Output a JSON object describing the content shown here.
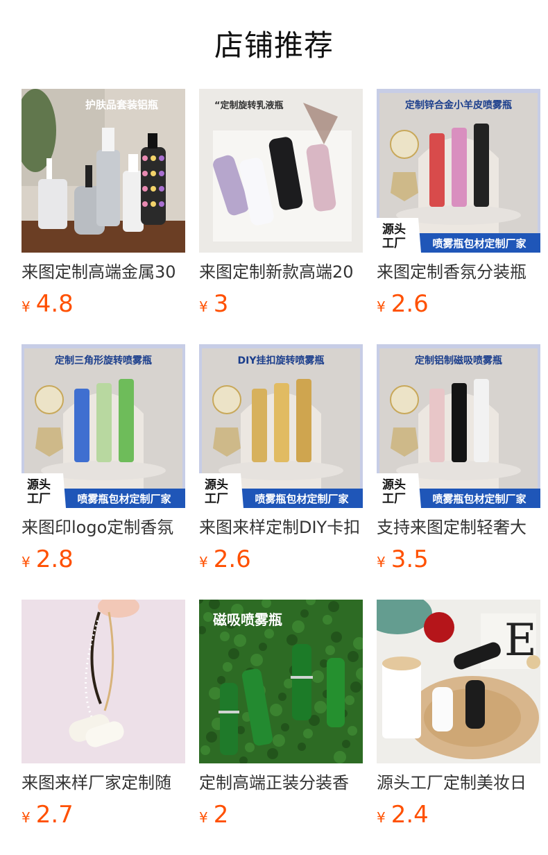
{
  "header": {
    "title": "店铺推荐"
  },
  "currency_symbol": "¥",
  "colors": {
    "price": "#ff5000",
    "banner": "#1f56b8"
  },
  "products": [
    {
      "name": "来图定制高端金属30",
      "price": "4.8",
      "image": {
        "headline": "护肤品套装铝瓶",
        "scene": "aluminum-bottles"
      }
    },
    {
      "name": "来图定制新款高端20",
      "price": "3",
      "image": {
        "headline": "“定制旋转乳液瓶",
        "scene": "rotary-lotion-bottles"
      }
    },
    {
      "name": "来图定制香氛分装瓶",
      "price": "2.6",
      "image": {
        "headline": "定制锌合金小羊皮喷雾瓶",
        "badge": "源头工厂",
        "banner": "喷雾瓶包材定制厂家",
        "scene": "spray-studio"
      }
    },
    {
      "name": "来图印logo定制香氛",
      "price": "2.8",
      "image": {
        "headline": "定制三角形旋转喷雾瓶",
        "badge": "源头工厂",
        "banner": "喷雾瓶包材定制厂家",
        "scene": "spray-studio"
      }
    },
    {
      "name": "来图来样定制DIY卡扣",
      "price": "2.6",
      "image": {
        "headline": "DIY挂扣旋转喷雾瓶",
        "badge": "源头工厂",
        "banner": "喷雾瓶包材定制厂家",
        "scene": "spray-studio"
      }
    },
    {
      "name": "支持来图定制轻奢大",
      "price": "3.5",
      "image": {
        "headline": "定制铝制磁吸喷雾瓶",
        "badge": "源头工厂",
        "banner": "喷雾瓶包材定制厂家",
        "scene": "spray-studio"
      }
    },
    {
      "name": "来图来样厂家定制随",
      "price": "2.7",
      "image": {
        "scene": "pink-chain"
      }
    },
    {
      "name": "定制高端正装分装香",
      "price": "2",
      "image": {
        "headline": "磁吸喷雾瓶",
        "scene": "green-grass"
      }
    },
    {
      "name": "源头工厂定制美妆日",
      "price": "2.4",
      "image": {
        "scene": "rattan-tray"
      }
    }
  ]
}
